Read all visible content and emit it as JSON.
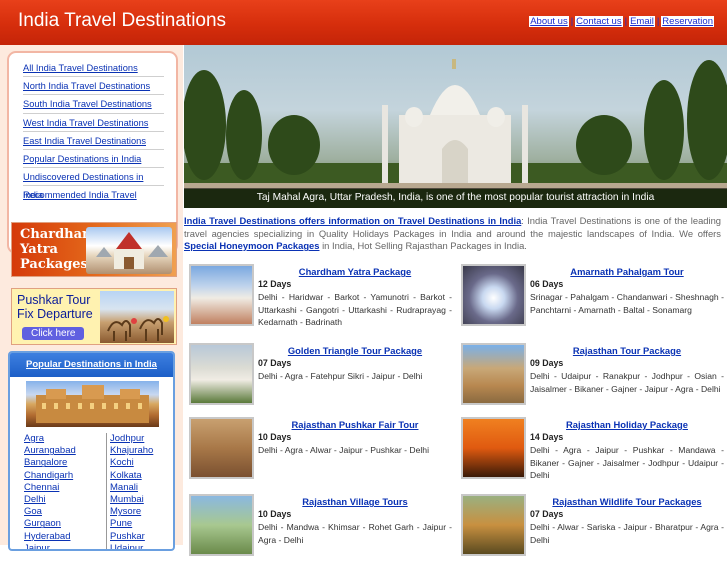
{
  "header": {
    "title": "India Travel Destinations",
    "links": [
      "About us",
      "Contact us",
      "Email",
      "Reservation"
    ]
  },
  "nav": {
    "items": [
      "All India Travel Destinations",
      "North India Travel Destinations",
      "South India Travel Destinations",
      "West India Travel Destinations",
      "East India Travel Destinations",
      "Popular Destinations in India",
      "Undiscovered Destinations in India",
      "Recommended India Travel"
    ]
  },
  "promos": {
    "chardham": {
      "line1": "Chardham",
      "line2": "Yatra",
      "line3": "Packages"
    },
    "pushkar": {
      "line1": "Pushkar Tour",
      "line2": "Fix Departure",
      "button": "Click here"
    }
  },
  "popular": {
    "heading": "Popular Destinations in India",
    "col_a": [
      "Agra",
      "Aurangabad",
      "Bangalore",
      "Chandigarh",
      "Chennai",
      "Delhi",
      "Goa",
      "Gurgaon",
      "Hyderabad",
      "Jaipur"
    ],
    "col_b": [
      "Jodhpur",
      "Khajuraho",
      "Kochi",
      "Kolkata",
      "Manali",
      "Mumbai",
      "Mysore",
      "Pune",
      "Pushkar",
      "Udaipur"
    ]
  },
  "hero": {
    "caption": "Taj Mahal Agra, Uttar Pradesh, India, is one of the most popular tourist attraction in India"
  },
  "intro": {
    "link1": "India Travel Destinations offers information on Travel Destinations in India",
    "text1": ": India Travel Destinations is one of the leading travel agencies specializing in Quality Holidays Packages in India and around the majestic landscapes of India. We offers ",
    "link2": "Special Honeymoon Packages",
    "text2": " in India, Hot Selling Rajasthan Packages in India."
  },
  "packages": [
    {
      "title": "Chardham Yatra Package",
      "days": "12 Days",
      "route": "Delhi - Haridwar - Barkot - Yamunotri - Barkot - Uttarkashi - Gangotri - Uttarkashi - Rudraprayag - Kedarnath - Badrinath"
    },
    {
      "title": "Amarnath Pahalgam Tour",
      "days": "06 Days",
      "route": "Srinagar - Pahalgam - Chandanwari - Sheshnagh - Panchtarni - Amarnath - Baltal - Sonamarg"
    },
    {
      "title": "Golden Triangle Tour Package",
      "days": "07 Days",
      "route": "Delhi - Agra - Fatehpur Sikri - Jaipur - Delhi"
    },
    {
      "title": "Rajasthan Tour Package",
      "days": "09 Days",
      "route": "Delhi - Udaipur - Ranakpur - Jodhpur - Osian - Jaisalmer - Bikaner - Gajner - Jaipur - Agra - Delhi"
    },
    {
      "title": "Rajasthan Pushkar Fair Tour",
      "days": "10 Days",
      "route": "Delhi - Agra - Alwar - Jaipur - Pushkar - Delhi"
    },
    {
      "title": "Rajasthan Holiday Package",
      "days": "14 Days",
      "route": "Delhi - Agra - Jaipur - Pushkar - Mandawa - Bikaner - Gajner - Jaisalmer - Jodhpur - Udaipur - Delhi"
    },
    {
      "title": "Rajasthan Village Tours",
      "days": "10 Days",
      "route": "Delhi - Mandwa - Khimsar - Rohet Garh - Jaipur - Agra - Delhi"
    },
    {
      "title": "Rajasthan Wildlife Tour Packages",
      "days": "07 Days",
      "route": "Delhi - Alwar - Sariska - Jaipur - Bharatpur - Agra - Delhi"
    }
  ],
  "colors": {
    "header_red": "#d62e0c",
    "link_blue": "#0a32b4",
    "sidebar_bg": "#fdeade"
  }
}
